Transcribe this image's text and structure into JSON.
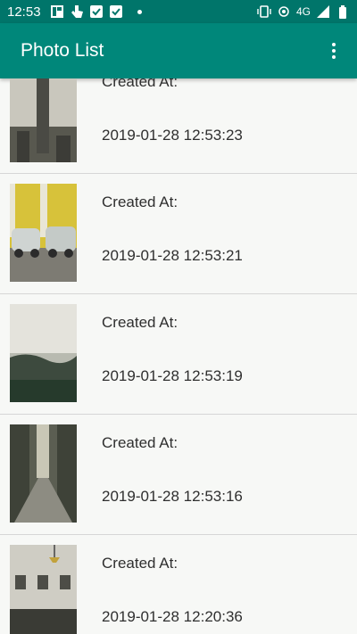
{
  "status_bar": {
    "time": "12:53",
    "network": "4G"
  },
  "app_bar": {
    "title": "Photo List"
  },
  "list": {
    "items": [
      {
        "label": "Created At:",
        "date": "2019-01-28 12:53:23"
      },
      {
        "label": "Created At:",
        "date": "2019-01-28 12:53:21"
      },
      {
        "label": "Created At:",
        "date": "2019-01-28 12:53:19"
      },
      {
        "label": "Created At:",
        "date": "2019-01-28 12:53:16"
      },
      {
        "label": "Created At:",
        "date": "2019-01-28 12:20:36"
      }
    ]
  },
  "colors": {
    "status_bar": "#00756a",
    "app_bar": "#00877a",
    "background": "#f7f8f6"
  }
}
